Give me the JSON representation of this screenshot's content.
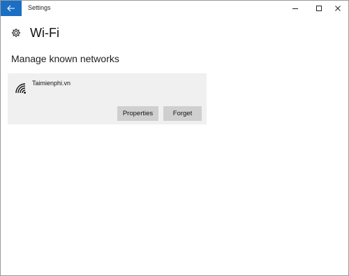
{
  "window": {
    "title": "Settings",
    "controls": [
      "minimize-icon",
      "maximize-icon",
      "close-icon"
    ],
    "accent_color": "#1a6fc4"
  },
  "page": {
    "icon": "gear-icon",
    "title": "Wi-Fi",
    "section_title": "Manage known networks"
  },
  "networks": [
    {
      "icon": "wifi-icon",
      "name": "Taimienphi.vn",
      "buttons": {
        "properties": "Properties",
        "forget": "Forget"
      }
    }
  ]
}
